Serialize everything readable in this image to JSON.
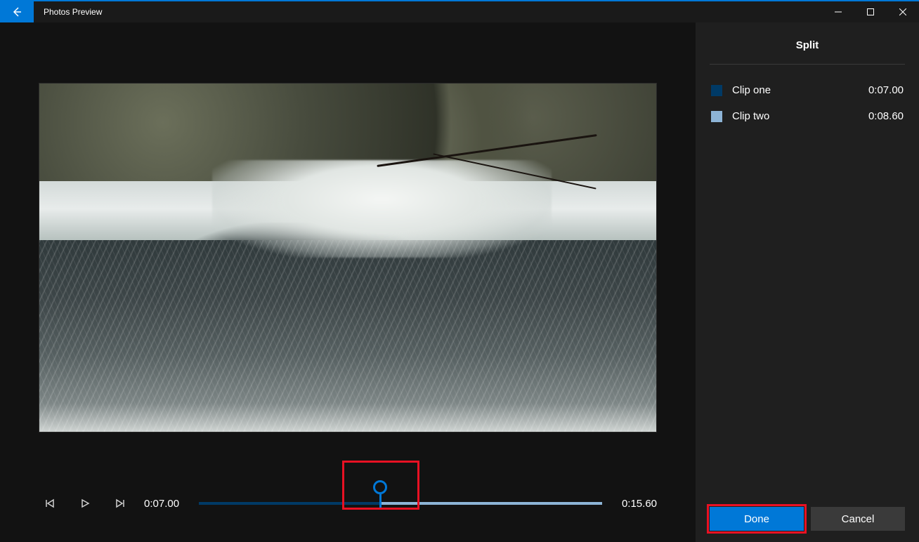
{
  "header": {
    "app_title": "Photos Preview"
  },
  "timeline": {
    "current_time": "0:07.00",
    "total_time": "0:15.60",
    "split_percent": 45
  },
  "sidebar": {
    "title": "Split",
    "clips": [
      {
        "name": "Clip one",
        "time": "0:07.00",
        "swatch": "dark"
      },
      {
        "name": "Clip two",
        "time": "0:08.60",
        "swatch": "light"
      }
    ],
    "done_label": "Done",
    "cancel_label": "Cancel"
  },
  "colors": {
    "accent": "#0078d7",
    "highlight": "#e81123"
  }
}
